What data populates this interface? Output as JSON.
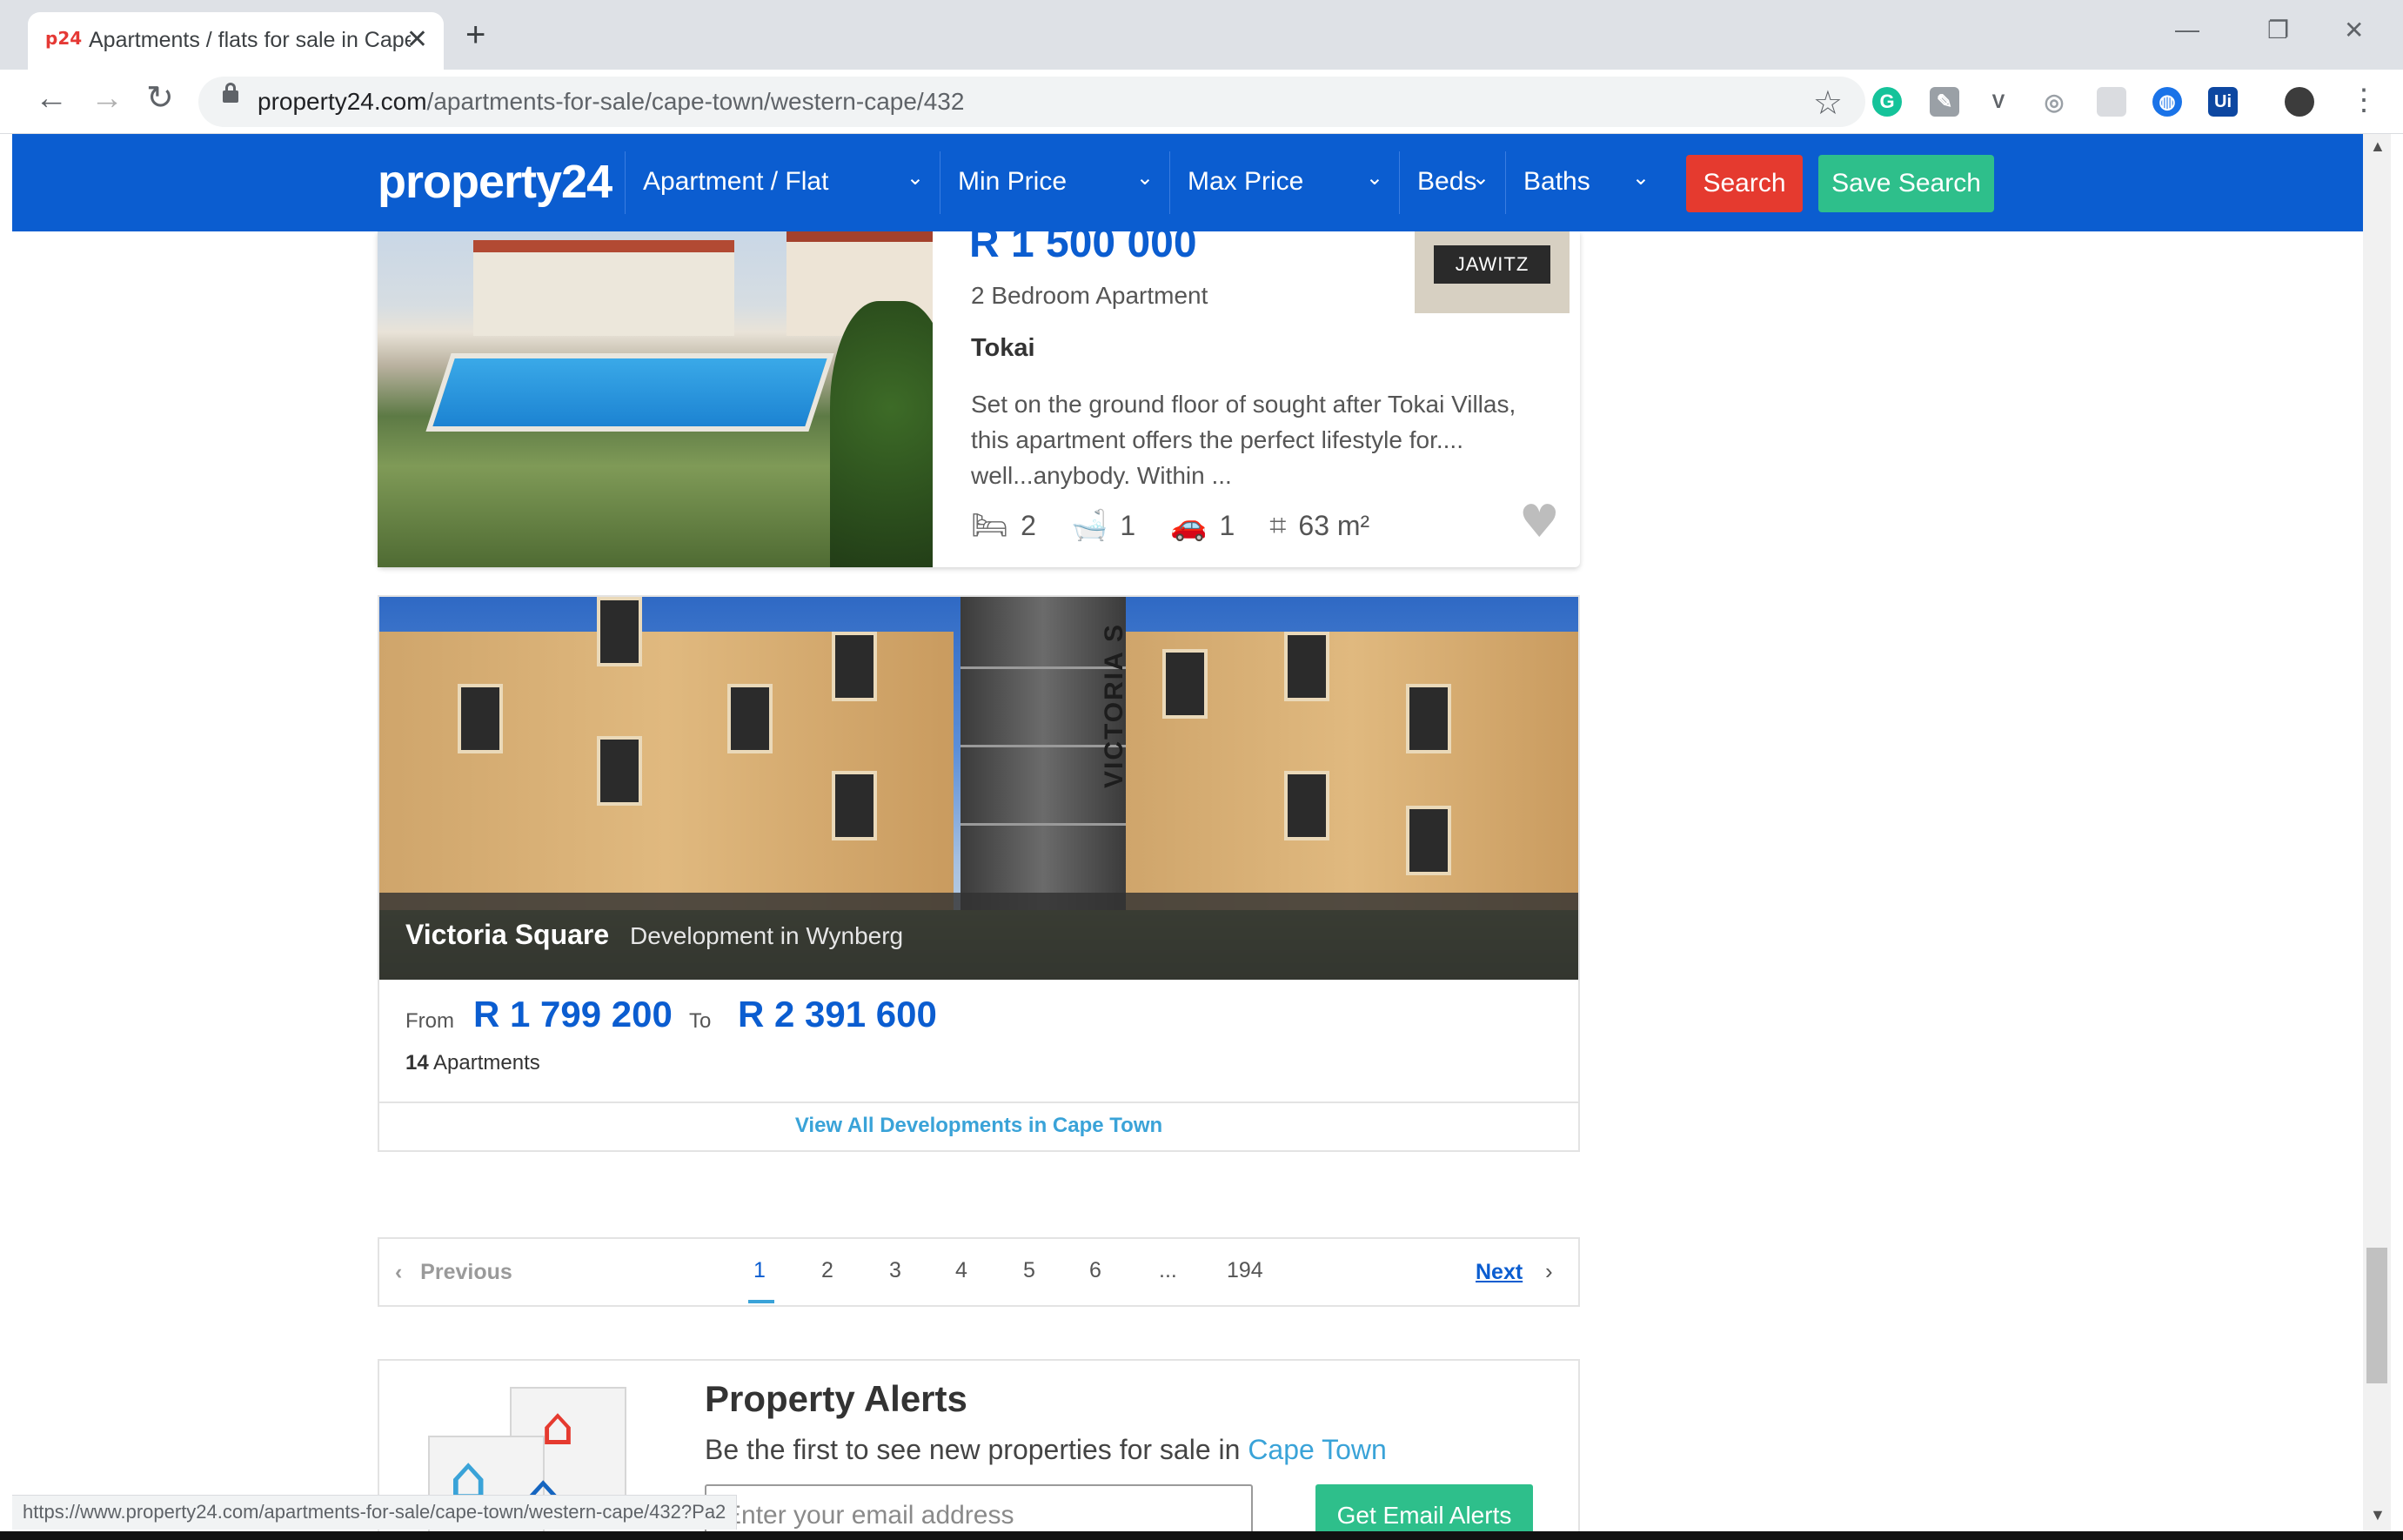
{
  "browser": {
    "tab_title": "Apartments / flats for sale in Cape Town",
    "favicon_text": "p24",
    "url_host": "property24.com",
    "url_path": "/apartments-for-sale/cape-town/western-cape/432",
    "status_url": "https://www.property24.com/apartments-for-sale/cape-town/western-cape/432?Pa2"
  },
  "header": {
    "logo": "property24",
    "filters": [
      "Apartment / Flat",
      "Min Price",
      "Max Price",
      "Beds",
      "Baths"
    ],
    "search_label": "Search",
    "save_search_label": "Save Search"
  },
  "listing": {
    "price": "R 1 500 000",
    "agency": "JAWITZ",
    "type": "2 Bedroom Apartment",
    "suburb": "Tokai",
    "description": "Set on the ground floor of sought after Tokai Villas, this apartment offers the perfect lifestyle for.... well...anybody. Within ...",
    "bedrooms": "2",
    "bathrooms": "1",
    "parking": "1",
    "size": "63 m²"
  },
  "development": {
    "name": "Victoria Square",
    "location": "Development in Wynberg",
    "from_label": "From",
    "price_from": "R 1 799 200",
    "to_label": "To",
    "price_to": "R 2 391 600",
    "count": "14",
    "count_label": "Apartments",
    "view_all": "View All Developments in Cape Town",
    "building_sign": "VICTORIA S"
  },
  "pagination": {
    "previous": "Previous",
    "pages": [
      "1",
      "2",
      "3",
      "4",
      "5",
      "6",
      "...",
      "194"
    ],
    "active_page": "1",
    "next": "Next"
  },
  "alerts": {
    "title": "Property Alerts",
    "subtitle": "Be the first to see new properties for sale in",
    "city": "Cape Town",
    "email_placeholder": "Enter your email address",
    "button": "Get Email Alerts"
  },
  "colors": {
    "brand_blue": "#0b5dd0",
    "search_red": "#e53a2f",
    "accent_green": "#2ebf8b",
    "link_blue": "#3aa3d8"
  }
}
